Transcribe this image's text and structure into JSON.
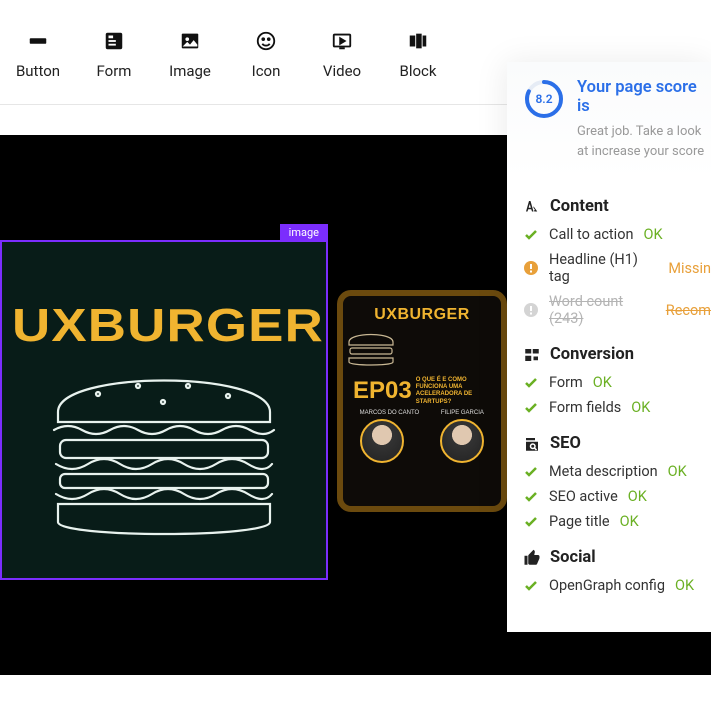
{
  "toolbar": [
    {
      "name": "button",
      "label": "Button",
      "icon": "button"
    },
    {
      "name": "form",
      "label": "Form",
      "icon": "form"
    },
    {
      "name": "image",
      "label": "Image",
      "icon": "image"
    },
    {
      "name": "icon",
      "label": "Icon",
      "icon": "smile"
    },
    {
      "name": "video",
      "label": "Video",
      "icon": "video"
    },
    {
      "name": "block",
      "label": "Block",
      "icon": "block"
    }
  ],
  "canvas": {
    "selected_label": "image",
    "image1_title": "UXBURGER",
    "card2": {
      "title": "UXBURGER",
      "episode": "EP03",
      "subtitle": "O QUE É E COMO FUNCIONA UMA ACELERADORA DE STARTUPS?",
      "people": [
        {
          "name": "MARCOS DO CANTO"
        },
        {
          "name": "FILIPE GARCIA"
        }
      ]
    }
  },
  "panel": {
    "score": "8.2",
    "title": "Your page score is",
    "subtitle": "Great job. Take a look at increase your score",
    "sections": [
      {
        "name": "content",
        "title": "Content",
        "icon": "content",
        "items": [
          {
            "label": "Call to action",
            "status": "OK",
            "state": "ok"
          },
          {
            "label": "Headline (H1) tag",
            "status": "Missin",
            "state": "warn"
          },
          {
            "label": "Word count (243)",
            "status": "Recom",
            "state": "strike"
          }
        ]
      },
      {
        "name": "conversion",
        "title": "Conversion",
        "icon": "conversion",
        "items": [
          {
            "label": "Form",
            "status": "OK",
            "state": "ok"
          },
          {
            "label": "Form fields",
            "status": "OK",
            "state": "ok"
          }
        ]
      },
      {
        "name": "seo",
        "title": "SEO",
        "icon": "seo",
        "items": [
          {
            "label": "Meta description",
            "status": "OK",
            "state": "ok"
          },
          {
            "label": "SEO active",
            "status": "OK",
            "state": "ok"
          },
          {
            "label": "Page title",
            "status": "OK",
            "state": "ok"
          }
        ]
      },
      {
        "name": "social",
        "title": "Social",
        "icon": "social",
        "items": [
          {
            "label": "OpenGraph config",
            "status": "OK",
            "state": "ok"
          }
        ]
      }
    ]
  }
}
